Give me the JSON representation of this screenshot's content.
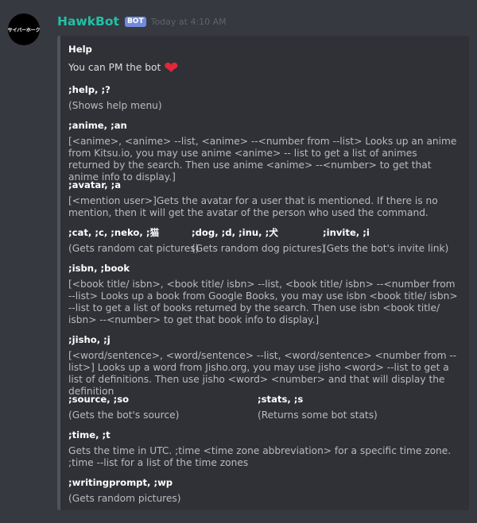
{
  "author": {
    "avatar_text": "サイバーホーク",
    "name": "HawkBot",
    "tag": "BOT",
    "timestamp": "Today at 4:10 AM"
  },
  "embed": {
    "title": "Help",
    "intro": "You can PM the bot",
    "intro_emoji": "❤",
    "fields": [
      {
        "name": ";help, ;?",
        "value": "(Shows help menu)"
      },
      {
        "name": ";anime, ;an",
        "value": "[<anime>, <anime> --list, <anime> --<number from --list> Looks up an anime from Kitsu.io, you may use anime <anime> -- list to get a list of animes returned by the search. Then use anime <anime> --<number> to get that anime info to display.]"
      },
      {
        "name": ";avatar, ;a",
        "value": "[<mention user>]Gets the avatar for a user that is mentioned. If there is no mention, then it will get the avatar of the person who used the command."
      },
      {
        "name": ";cat, ;c, ;neko, ;猫",
        "value": "(Gets random cat pictures)"
      },
      {
        "name": ";dog, ;d, ;inu, ;犬",
        "value": "(Gets random dog pictures)"
      },
      {
        "name": ";invite, ;i",
        "value": "(Gets the bot's invite link)"
      },
      {
        "name": ";isbn, ;book",
        "value": "[<book title/ isbn>, <book title/ isbn> --list, <book title/ isbn> --<number from --list> Looks up a book from Google Books, you may use isbn <book title/ isbn> --list to get a list of books returned by the search. Then use isbn <book title/ isbn> --<number> to get that book info to display.]"
      },
      {
        "name": ";jisho, ;j",
        "value": "[<word/sentence>, <word/sentence> --list, <word/sentence> <number from --list>] Looks up a word from Jisho.org, you may use jisho <word> --list to get a list of definitions. Then use jisho <word> <number> and that will display the definition"
      },
      {
        "name": ";source, ;so",
        "value": "(Gets the bot's source)"
      },
      {
        "name": ";stats, ;s",
        "value": "(Returns some bot stats)"
      },
      {
        "name": ";time, ;t",
        "value": "Gets the time in UTC. ;time <time zone abbreviation> for a specific time zone. ;time --list for a list of the time zones"
      },
      {
        "name": ";writingprompt, ;wp",
        "value": "(Gets random pictures)"
      }
    ]
  }
}
